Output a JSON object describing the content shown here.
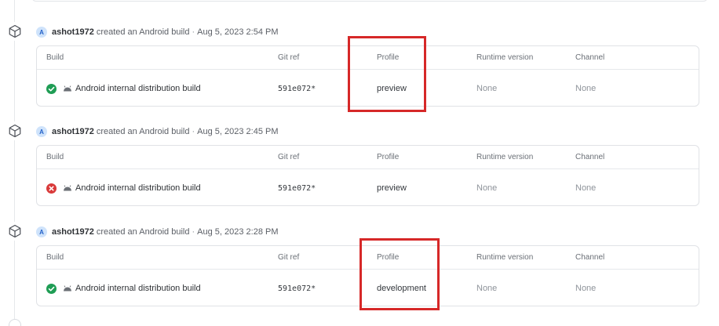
{
  "icons": {
    "timeline": "package-box-icon",
    "success": "check-circle-icon",
    "failure": "x-circle-icon",
    "platform": "android-icon"
  },
  "colors": {
    "success": "#1f9d55",
    "failure": "#d93a3a",
    "highlight": "#d62828",
    "avatar_bg": "#cfe3fb",
    "avatar_fg": "#2563c9"
  },
  "activities": [
    {
      "avatar_letter": "A",
      "username": "ashot1972",
      "action": "created an Android build",
      "separator": "·",
      "timestamp": "Aug 5, 2023 2:54 PM",
      "columns": {
        "build": "Build",
        "git_ref": "Git ref",
        "profile": "Profile",
        "runtime": "Runtime version",
        "channel": "Channel"
      },
      "row": {
        "status": "success",
        "build_name": "Android internal distribution build",
        "git_ref": "591e072*",
        "profile": "preview",
        "runtime": "None",
        "channel": "None"
      }
    },
    {
      "avatar_letter": "A",
      "username": "ashot1972",
      "action": "created an Android build",
      "separator": "·",
      "timestamp": "Aug 5, 2023 2:45 PM",
      "columns": {
        "build": "Build",
        "git_ref": "Git ref",
        "profile": "Profile",
        "runtime": "Runtime version",
        "channel": "Channel"
      },
      "row": {
        "status": "failure",
        "build_name": "Android internal distribution build",
        "git_ref": "591e072*",
        "profile": "preview",
        "runtime": "None",
        "channel": "None"
      }
    },
    {
      "avatar_letter": "A",
      "username": "ashot1972",
      "action": "created an Android build",
      "separator": "·",
      "timestamp": "Aug 5, 2023 2:28 PM",
      "columns": {
        "build": "Build",
        "git_ref": "Git ref",
        "profile": "Profile",
        "runtime": "Runtime version",
        "channel": "Channel"
      },
      "row": {
        "status": "success",
        "build_name": "Android internal distribution build",
        "git_ref": "591e072*",
        "profile": "development",
        "runtime": "None",
        "channel": "None"
      }
    }
  ]
}
